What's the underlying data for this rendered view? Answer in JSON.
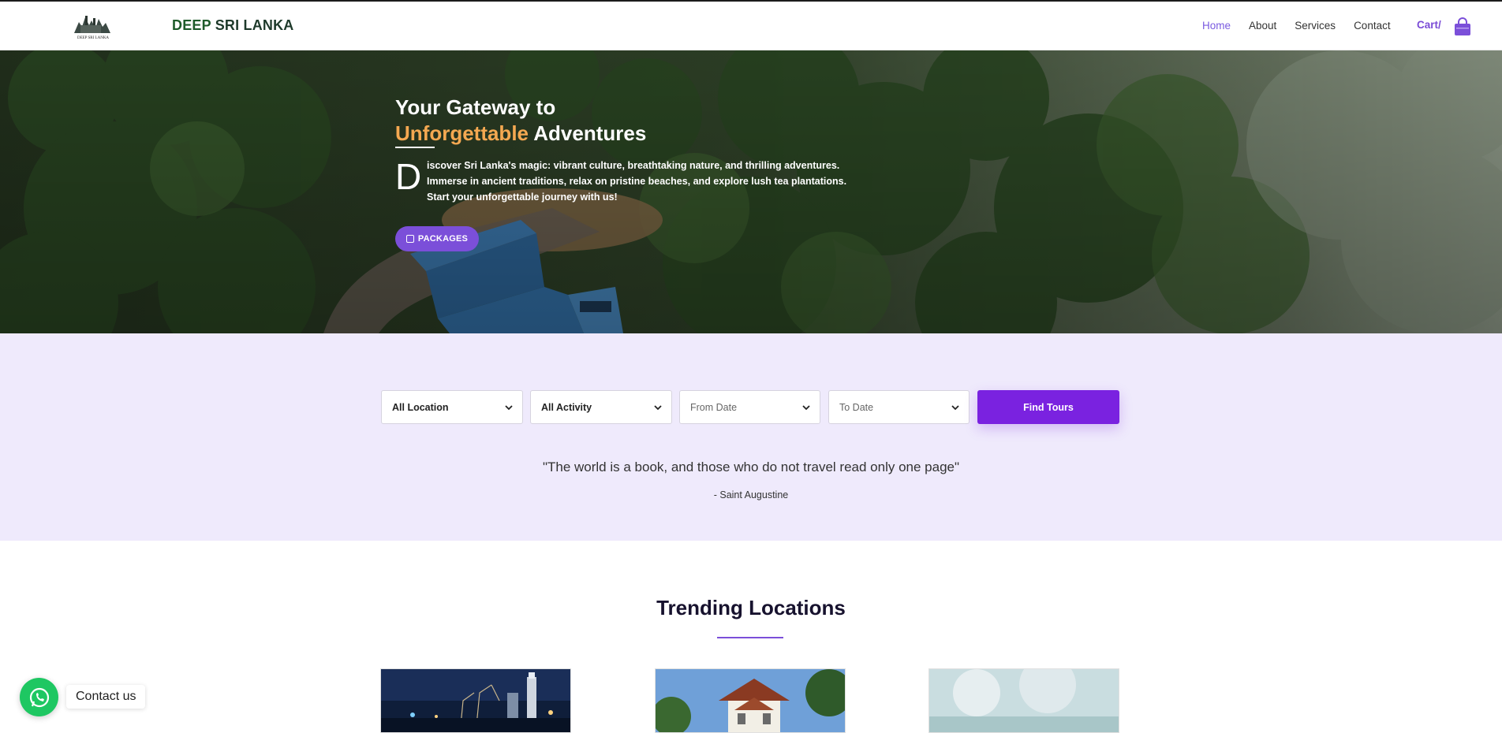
{
  "header": {
    "logo_text": "DEEP SRI LANKA",
    "brand_part1": "DEEP",
    "brand_part2": " SRI LANKA",
    "nav": [
      {
        "label": "Home",
        "active": true
      },
      {
        "label": "About",
        "active": false
      },
      {
        "label": "Services",
        "active": false
      },
      {
        "label": "Contact",
        "active": false
      }
    ],
    "cart_label": "Cart/",
    "cart_icon": "shopping-bag-icon"
  },
  "hero": {
    "title_line1": "Your Gateway to",
    "title_accent": "Unforgettable",
    "title_rest": " Adventures",
    "dropcap": "D",
    "text": "iscover Sri Lanka's magic: vibrant culture, breathtaking nature, and thrilling adventures. Immerse in ancient traditions, relax on pristine beaches, and explore lush tea plantations. Start your unforgettable journey with us!",
    "button_label": "PACKAGES",
    "button_icon": "package-icon"
  },
  "search": {
    "location": "All Location",
    "activity": "All Activity",
    "from_date": "From Date",
    "to_date": "To Date",
    "button_label": "Find Tours"
  },
  "quote": {
    "text": "\"The world is a book, and those who do not travel read only one page\"",
    "author": "- Saint Augustine"
  },
  "trending": {
    "title": "Trending Locations"
  },
  "contact_widget": {
    "label": "Contact us",
    "icon": "whatsapp-icon"
  },
  "colors": {
    "accent_purple": "#7a22e0",
    "nav_active": "#7a5ae0",
    "hero_accent": "#f4a851",
    "band_bg": "#efeafc",
    "whatsapp_green": "#1ec762"
  }
}
